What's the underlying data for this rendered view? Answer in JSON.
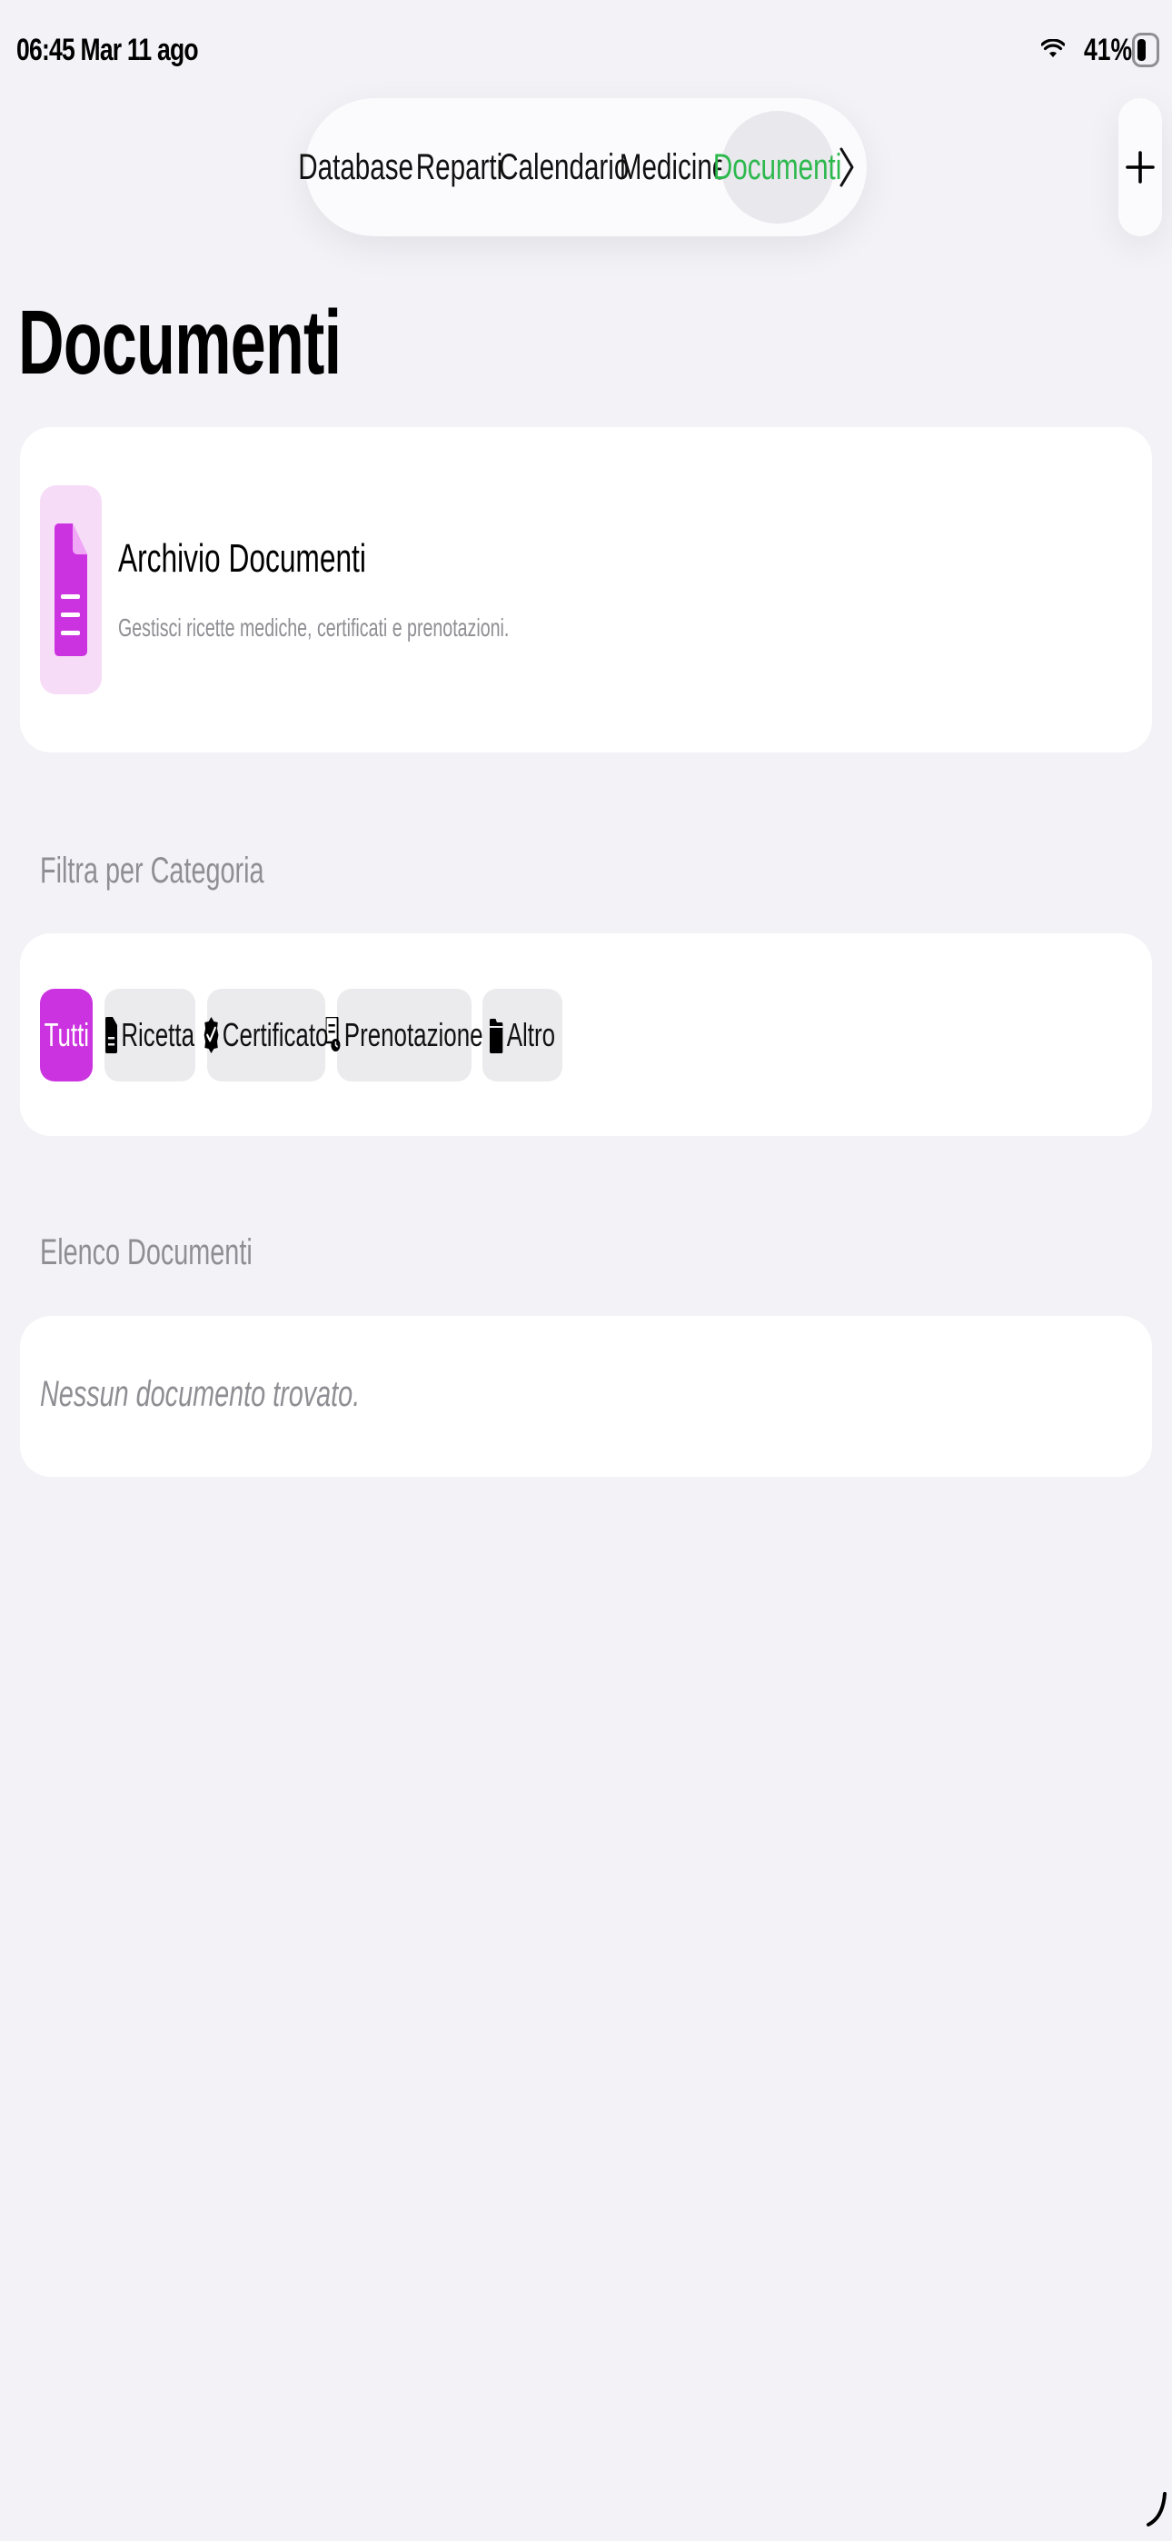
{
  "status_bar": {
    "time": "06:45  Mar 11 ago",
    "battery": "41%",
    "icons": [
      "wifi-icon",
      "battery-icon"
    ]
  },
  "nav": {
    "tabs": [
      {
        "label": "Database"
      },
      {
        "label": "Reparti"
      },
      {
        "label": "Calendario"
      },
      {
        "label": "Medicine"
      },
      {
        "label": "Documenti",
        "active": true
      }
    ],
    "more_icon": "chevron-right-icon",
    "add_icon": "plus-icon"
  },
  "page": {
    "title": "Documenti"
  },
  "archive": {
    "icon": "document-icon",
    "title": "Archivio Documenti",
    "subtitle": "Gestisci ricette mediche, certificati e prenotazioni."
  },
  "filter": {
    "header": "Filtra per Categoria",
    "chips": [
      {
        "label": "Tutti",
        "selected": true
      },
      {
        "label": "Ricetta",
        "icon": "document-icon"
      },
      {
        "label": "Certificato",
        "icon": "checkmark-seal-icon"
      },
      {
        "label": "Prenotazione",
        "icon": "calendar-document-icon"
      },
      {
        "label": "Altro",
        "icon": "folder-icon"
      }
    ]
  },
  "list": {
    "header": "Elenco Documenti",
    "empty_message": "Nessun documento trovato."
  },
  "colors": {
    "accent": "#cc33e0",
    "accent_light": "#f7dcf8",
    "active_tab_text": "#2db84d",
    "background": "#f2f2f7",
    "secondary_text": "#8e8e93"
  }
}
